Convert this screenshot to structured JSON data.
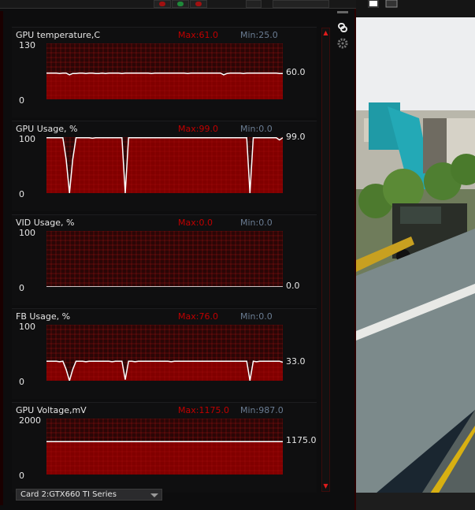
{
  "graphs": [
    {
      "title": "GPU temperature,C",
      "max": "Max:61.0",
      "min": "Min:25.0",
      "ymax_label": "130",
      "ymin_label": "0",
      "current": "60.0",
      "ymax": 130,
      "values": [
        61,
        61,
        61,
        61,
        60,
        61,
        61,
        57,
        60,
        60,
        61,
        61,
        60,
        61,
        61,
        60,
        60,
        61,
        60,
        61,
        61,
        61,
        61,
        60,
        61,
        61,
        61,
        61,
        61,
        61,
        61,
        61,
        60,
        61,
        61,
        61,
        61,
        61,
        61,
        61,
        61,
        61,
        61,
        60,
        61,
        61,
        61,
        61,
        61,
        61,
        61,
        61,
        61,
        61,
        57,
        60,
        61,
        61,
        61,
        61,
        60,
        61,
        61,
        61,
        61,
        61,
        61,
        61,
        61,
        61,
        61,
        60,
        60
      ]
    },
    {
      "title": "GPU Usage, %",
      "max": "Max:99.0",
      "min": "Min:0.0",
      "ymax_label": "100",
      "ymin_label": "0",
      "current": "99.0",
      "ymax": 100,
      "values": [
        99,
        99,
        99,
        99,
        99,
        99,
        60,
        0,
        60,
        99,
        99,
        99,
        99,
        99,
        98,
        99,
        99,
        99,
        99,
        99,
        99,
        99,
        99,
        99,
        0,
        99,
        99,
        99,
        99,
        99,
        99,
        99,
        99,
        99,
        99,
        99,
        99,
        99,
        99,
        99,
        99,
        99,
        99,
        99,
        99,
        99,
        99,
        99,
        99,
        99,
        99,
        99,
        99,
        99,
        99,
        99,
        99,
        99,
        99,
        99,
        99,
        99,
        0,
        99,
        99,
        99,
        99,
        99,
        99,
        99,
        99,
        95,
        99
      ]
    },
    {
      "title": "VID Usage, %",
      "max": "Max:0.0",
      "min": "Min:0.0",
      "ymax_label": "100",
      "ymin_label": "0",
      "current": "0.0",
      "ymax": 100,
      "values": [
        0,
        0,
        0,
        0,
        0,
        0,
        0,
        0,
        0,
        0,
        0,
        0,
        0,
        0,
        0,
        0,
        0,
        0,
        0,
        0,
        0,
        0,
        0,
        0,
        0,
        0,
        0,
        0,
        0,
        0,
        0,
        0,
        0,
        0,
        0,
        0,
        0,
        0,
        0,
        0,
        0,
        0,
        0,
        0,
        0,
        0,
        0,
        0,
        0,
        0,
        0,
        0,
        0,
        0,
        0,
        0,
        0,
        0,
        0,
        0,
        0,
        0,
        0,
        0,
        0,
        0,
        0,
        0,
        0,
        0,
        0,
        0,
        0
      ]
    },
    {
      "title": "FB Usage, %",
      "max": "Max:76.0",
      "min": "Min:0.0",
      "ymax_label": "100",
      "ymin_label": "0",
      "current": "33.0",
      "ymax": 100,
      "values": [
        35,
        35,
        35,
        35,
        34,
        35,
        20,
        0,
        20,
        35,
        35,
        35,
        34,
        35,
        35,
        35,
        35,
        35,
        35,
        35,
        34,
        35,
        35,
        35,
        2,
        35,
        35,
        34,
        35,
        35,
        35,
        35,
        35,
        35,
        35,
        35,
        35,
        35,
        34,
        35,
        35,
        35,
        35,
        35,
        35,
        35,
        35,
        35,
        35,
        35,
        35,
        35,
        35,
        35,
        35,
        35,
        35,
        35,
        35,
        35,
        35,
        35,
        0,
        35,
        34,
        35,
        35,
        35,
        35,
        35,
        35,
        35,
        33
      ]
    },
    {
      "title": "GPU Voltage,mV",
      "max": "Max:1175.0",
      "min": "Min:987.0",
      "ymax_label": "2000",
      "ymin_label": "0",
      "current": "1175.0",
      "ymax": 2000,
      "values": [
        1175,
        1175,
        1175,
        1175,
        1175,
        1175,
        1175,
        1175,
        1175,
        1175,
        1175,
        1175,
        1175,
        1175,
        1175,
        1175,
        1175,
        1175,
        1175,
        1175,
        1175,
        1175,
        1175,
        1175,
        1175,
        1175,
        1175,
        1175,
        1175,
        1175,
        1175,
        1175,
        1175,
        1175,
        1175,
        1175,
        1175,
        1175,
        1175,
        1175,
        1175,
        1175,
        1175,
        1175,
        1175,
        1175,
        1175,
        1175,
        1175,
        1175,
        1175,
        1175,
        1175,
        1175,
        1175,
        1175,
        1175,
        1175,
        1175,
        1175,
        1175,
        1175,
        1175,
        1175,
        1175,
        1175,
        1175,
        1175,
        1175,
        1175,
        1175,
        1175,
        1175
      ]
    }
  ],
  "bottom": {
    "card_select": "Card 2:GTX660 TI Series"
  },
  "icons": [
    "link-icon",
    "gear-icon"
  ],
  "colors": {
    "fill": "#8b0000",
    "grid": "#c81818",
    "line": "#ffffff",
    "max_label": "#c00000",
    "min_label": "#6a7c92"
  }
}
